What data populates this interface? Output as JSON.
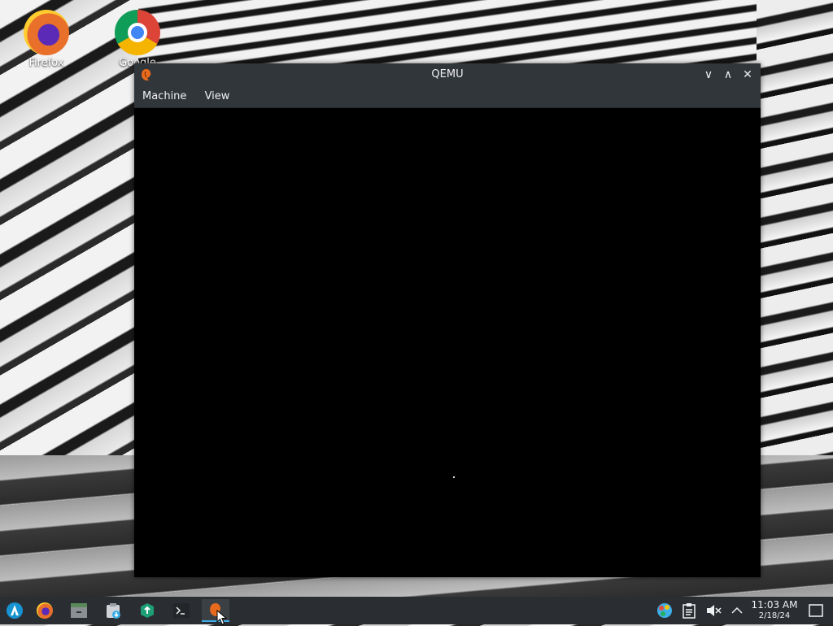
{
  "desktop": {
    "icons": [
      {
        "label": "Firefox",
        "icon": "firefox-icon"
      },
      {
        "label": "Google",
        "icon": "chrome-icon"
      }
    ]
  },
  "window": {
    "title": "QEMU",
    "menu": [
      "Machine",
      "View"
    ],
    "controls": {
      "minimize": "∨",
      "maximize": "∧",
      "close": "✕"
    }
  },
  "taskbar": {
    "items": [
      "app-launcher-icon",
      "firefox-icon",
      "file-manager-icon",
      "package-manager-icon",
      "system-tool-icon",
      "terminal-icon",
      "qemu-icon"
    ],
    "clock": {
      "time": "11:03 AM",
      "date": "2/18/24"
    },
    "tray": [
      "color-picker-icon",
      "clipboard-icon",
      "volume-muted-icon",
      "tray-expand-icon",
      "show-desktop-icon"
    ]
  }
}
